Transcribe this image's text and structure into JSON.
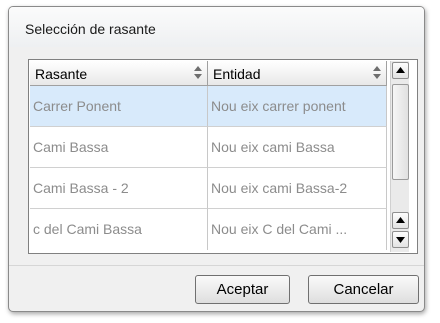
{
  "window": {
    "title": "Selección de rasante"
  },
  "grid": {
    "columns": [
      {
        "label": "Rasante"
      },
      {
        "label": "Entidad"
      }
    ],
    "rows": [
      {
        "rasante": "Carrer Ponent",
        "entidad": "Nou eix carrer ponent",
        "selected": true
      },
      {
        "rasante": "Cami Bassa",
        "entidad": "Nou eix cami Bassa",
        "selected": false
      },
      {
        "rasante": "Cami Bassa - 2",
        "entidad": "Nou eix cami Bassa-2",
        "selected": false
      },
      {
        "rasante": "c del Cami Bassa",
        "entidad": "Nou eix C del Cami ...",
        "selected": false
      }
    ]
  },
  "buttons": {
    "accept_label": "Aceptar",
    "cancel_label": "Cancelar"
  },
  "colors": {
    "selection": "#d8eafb",
    "cell_text": "#8c8c8c"
  }
}
